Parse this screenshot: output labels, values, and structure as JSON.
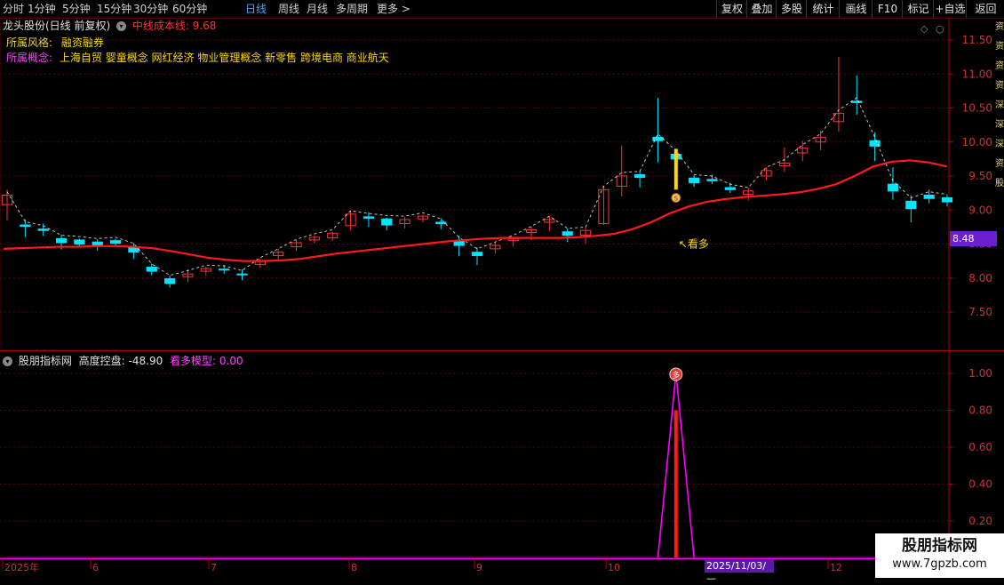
{
  "toolbar": {
    "periods": [
      "分时",
      "1分钟",
      "5分钟",
      "15分钟",
      "30分钟",
      "60分钟",
      "日线",
      "周线",
      "月线",
      "多周期",
      "更多 >"
    ],
    "active_period": "日线",
    "buttons": [
      "复权",
      "叠加",
      "多股",
      "统计",
      "画线",
      "F10",
      "标记",
      "+自选",
      "返回"
    ]
  },
  "main": {
    "stock_title": "龙头股份(日线 前复权)",
    "cost_line_label": "中线成本线: 9.68",
    "style_label": "所属风格:",
    "style_value": "融资融券",
    "concept_label": "所属概念:",
    "concept_value": "上海自贸 婴童概念 网红经济 物业管理概念 新零售 跨境电商 商业航天",
    "annotation": "↖看多",
    "coin_glyph": "S",
    "price_badge": "8.48",
    "yticks": [
      "11.50",
      "11.00",
      "10.50",
      "10.00",
      "9.50",
      "9.00",
      "8.50",
      "8.00",
      "7.50"
    ]
  },
  "sub": {
    "title": "股朋指标网",
    "indicator_label": "高度控盘: -48.90",
    "model_label": "看多模型: 0.00",
    "signal_glyph": "多",
    "yticks": [
      "1.00",
      "0.80",
      "0.60",
      "0.40",
      "0.20"
    ]
  },
  "xaxis": {
    "labels": [
      "2025年",
      "6",
      "7",
      "8",
      "9",
      "10",
      "12"
    ],
    "date_badge": "2025/11/03/—"
  },
  "watermark": {
    "line1": "股朋指标网",
    "line2": "www.7gpzb.com"
  },
  "right_strip_text": "资资资资深深深资股 ",
  "colors": {
    "up": "#ff3232",
    "down": "#00e5ff",
    "ma": "#ff1a1a",
    "signal": "#ff00ff",
    "accent": "#ffd700",
    "concept": "#ff40ff"
  },
  "chart_data": {
    "type": "candlestick",
    "y_range": [
      7.0,
      11.75
    ],
    "cost_line_value": 9.68,
    "series": [
      {
        "name": "中线成本线",
        "values": [
          8.43,
          8.44,
          8.45,
          8.46,
          8.46,
          8.47,
          8.47,
          8.46,
          8.44,
          8.4,
          8.35,
          8.3,
          8.27,
          8.25,
          8.25,
          8.26,
          8.28,
          8.32,
          8.36,
          8.39,
          8.42,
          8.45,
          8.48,
          8.51,
          8.54,
          8.56,
          8.58,
          8.59,
          8.59,
          8.59,
          8.59,
          8.6,
          8.62,
          8.65,
          8.72,
          8.82,
          8.95,
          9.05,
          9.12,
          9.16,
          9.19,
          9.21,
          9.23,
          9.26,
          9.31,
          9.38,
          9.5,
          9.64,
          9.71,
          9.73,
          9.7,
          9.64
        ]
      }
    ],
    "candles": [
      [
        9.08,
        9.22,
        8.85,
        9.3
      ],
      [
        8.78,
        8.76,
        8.6,
        8.86
      ],
      [
        8.72,
        8.7,
        8.62,
        8.8
      ],
      [
        8.58,
        8.52,
        8.42,
        8.64
      ],
      [
        8.56,
        8.5,
        8.45,
        8.58
      ],
      [
        8.53,
        8.47,
        8.4,
        8.57
      ],
      [
        8.55,
        8.51,
        8.47,
        8.58
      ],
      [
        8.46,
        8.38,
        8.28,
        8.51
      ],
      [
        8.16,
        8.1,
        8.04,
        8.21
      ],
      [
        7.99,
        7.92,
        7.86,
        8.04
      ],
      [
        8.02,
        8.06,
        7.94,
        8.13
      ],
      [
        8.1,
        8.14,
        8.04,
        8.17
      ],
      [
        8.13,
        8.12,
        8.06,
        8.19
      ],
      [
        8.06,
        8.05,
        7.97,
        8.13
      ],
      [
        8.2,
        8.25,
        8.15,
        8.29
      ],
      [
        8.33,
        8.38,
        8.27,
        8.43
      ],
      [
        8.46,
        8.52,
        8.4,
        8.56
      ],
      [
        8.56,
        8.6,
        8.51,
        8.63
      ],
      [
        8.59,
        8.66,
        8.55,
        8.68
      ],
      [
        8.77,
        8.94,
        8.7,
        8.99
      ],
      [
        8.9,
        8.88,
        8.75,
        8.97
      ],
      [
        8.87,
        8.78,
        8.7,
        8.89
      ],
      [
        8.8,
        8.86,
        8.73,
        8.9
      ],
      [
        8.87,
        8.91,
        8.82,
        8.93
      ],
      [
        8.82,
        8.8,
        8.72,
        8.88
      ],
      [
        8.55,
        8.48,
        8.32,
        8.62
      ],
      [
        8.38,
        8.33,
        8.19,
        8.45
      ],
      [
        8.43,
        8.48,
        8.36,
        8.53
      ],
      [
        8.55,
        8.58,
        8.46,
        8.6
      ],
      [
        8.67,
        8.71,
        8.56,
        8.76
      ],
      [
        8.82,
        8.86,
        8.69,
        8.91
      ],
      [
        8.68,
        8.63,
        8.53,
        8.73
      ],
      [
        8.63,
        8.7,
        8.5,
        8.75
      ],
      [
        8.8,
        9.3,
        8.78,
        9.35
      ],
      [
        9.35,
        9.5,
        9.2,
        9.95
      ],
      [
        9.52,
        9.48,
        9.33,
        9.58
      ],
      [
        10.07,
        10.02,
        9.7,
        10.65
      ],
      [
        9.82,
        9.75,
        9.62,
        9.9
      ],
      [
        9.47,
        9.4,
        9.34,
        9.51
      ],
      [
        9.45,
        9.43,
        9.38,
        9.52
      ],
      [
        9.33,
        9.3,
        9.25,
        9.4
      ],
      [
        9.23,
        9.28,
        9.14,
        9.33
      ],
      [
        9.5,
        9.58,
        9.44,
        9.63
      ],
      [
        9.65,
        9.69,
        9.56,
        9.92
      ],
      [
        9.84,
        9.91,
        9.72,
        10.02
      ],
      [
        10.0,
        10.07,
        9.88,
        10.16
      ],
      [
        10.3,
        10.42,
        10.15,
        11.25
      ],
      [
        10.6,
        10.58,
        10.4,
        10.98
      ],
      [
        10.02,
        9.94,
        9.72,
        10.14
      ],
      [
        9.38,
        9.28,
        9.15,
        9.63
      ],
      [
        9.13,
        9.02,
        8.82,
        9.22
      ],
      [
        9.22,
        9.17,
        9.1,
        9.3
      ],
      [
        9.18,
        9.12,
        9.05,
        9.22
      ]
    ],
    "candles_fields": [
      "open",
      "close",
      "low",
      "high"
    ],
    "sub_range": [
      0,
      1.1
    ],
    "signal": {
      "name": "看多模型",
      "values": [
        0,
        0,
        0,
        0,
        0,
        0,
        0,
        0,
        0,
        0,
        0,
        0,
        0,
        0,
        0,
        0,
        0,
        0,
        0,
        0,
        0,
        0,
        0,
        0,
        0,
        0,
        0,
        0,
        0,
        0,
        0,
        0,
        0,
        0,
        0,
        0,
        0,
        1,
        0,
        0,
        0,
        0,
        0,
        0,
        0,
        0,
        0,
        0,
        0,
        0,
        0,
        0,
        0
      ]
    }
  }
}
